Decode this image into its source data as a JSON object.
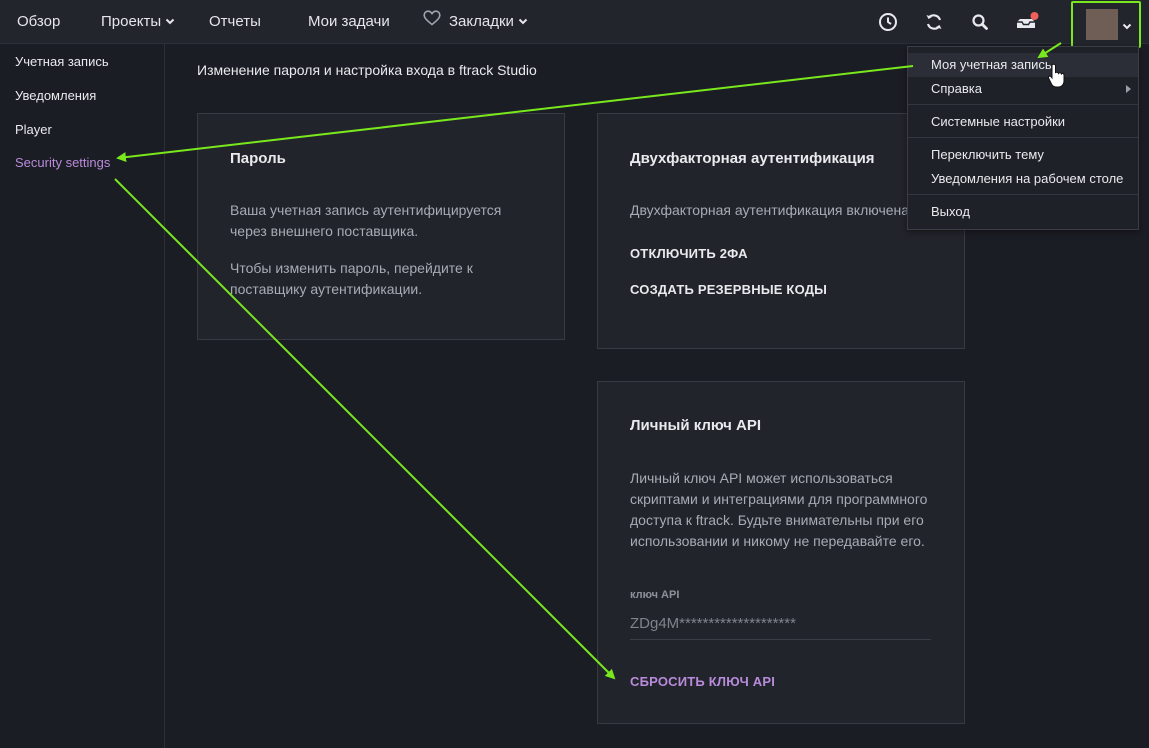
{
  "topnav": {
    "overview": "Обзор",
    "projects": "Проекты",
    "reports": "Отчеты",
    "my_tasks": "Мои задачи",
    "bookmarks": "Закладки",
    "icons": [
      "clock-icon",
      "sync-icon",
      "search-icon",
      "inbox-icon",
      "chevron-down-icon",
      "heart-icon"
    ],
    "notification_color": "#f0605a"
  },
  "sidebar": {
    "items": [
      {
        "label": "Учетная запись"
      },
      {
        "label": "Уведомления"
      },
      {
        "label": "Player"
      },
      {
        "label": "Security settings"
      }
    ],
    "active_color": "#b98bdb"
  },
  "main": {
    "title": "Изменение пароля и настройка входа в ftrack Studio",
    "password_card": {
      "title": "Пароль",
      "text1": "Ваша учетная запись аутентифицируется через внешнего поставщика.",
      "text2": "Чтобы изменить пароль, перейдите к поставщику аутентификации."
    },
    "twofa_card": {
      "title": "Двухфакторная аутентификация",
      "text": "Двухфакторная аутентификация включена",
      "disable": "ОТКЛЮЧИТЬ 2ФА",
      "backup_codes": "СОЗДАТЬ РЕЗЕРВНЫЕ КОДЫ"
    },
    "api_card": {
      "title": "Личный ключ API",
      "text": "Личный ключ API может использоваться скриптами и интеграциями для программного доступа к ftrack. Будьте внимательны при его использовании и никому не передавайте его.",
      "key_label": "ключ API",
      "key_value": "ZDg4M********************",
      "reset": "СБРОСИТЬ КЛЮЧ API"
    }
  },
  "dropdown": {
    "my_account": "Моя учетная запись",
    "help": "Справка",
    "system_settings": "Системные настройки",
    "switch_theme": "Переключить тему",
    "desktop_notifications": "Уведомления на рабочем столе",
    "logout": "Выход"
  },
  "annotation_color": "#79e81c"
}
